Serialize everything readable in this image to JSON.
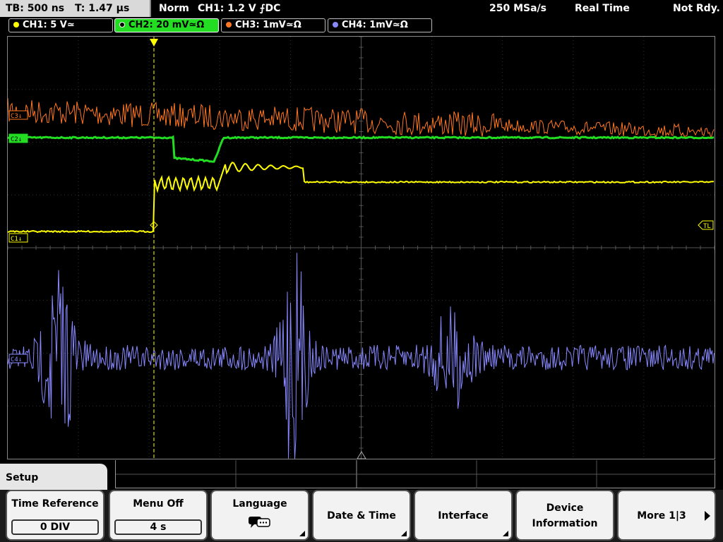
{
  "status": {
    "timebase": "TB: 500 ns",
    "trigger_time": "T: 1.47 µs",
    "mode": "Norm",
    "trigger_info": "CH1: 1.2 V ⨍DC",
    "sample_rate": "250 MSa/s",
    "acq_mode": "Real Time",
    "ready_state": "Not Rdy."
  },
  "channels": [
    {
      "label": "CH1: 5 V≃",
      "color": "#ffff00"
    },
    {
      "label": "CH2: 20 mV≃Ω",
      "color": "#22dd22"
    },
    {
      "label": "CH3: 1mV≃Ω",
      "color": "#ff7722"
    },
    {
      "label": "CH4: 1mV≃Ω",
      "color": "#8888ff"
    }
  ],
  "markers": {
    "ch1": "C1↓",
    "ch2": "C2↓",
    "ch3": "C3↓",
    "ch4": "C4↓",
    "trigger_level": "TL"
  },
  "menu": {
    "title": "Setup",
    "buttons": [
      {
        "label": "Time Reference",
        "value": "0 DIV"
      },
      {
        "label": "Menu Off",
        "value": "4 s"
      },
      {
        "label": "Language"
      },
      {
        "label": "Date & Time"
      },
      {
        "label": "Interface"
      },
      {
        "label": "Device",
        "label2": "Information"
      },
      {
        "label": "More 1|3"
      }
    ]
  }
}
